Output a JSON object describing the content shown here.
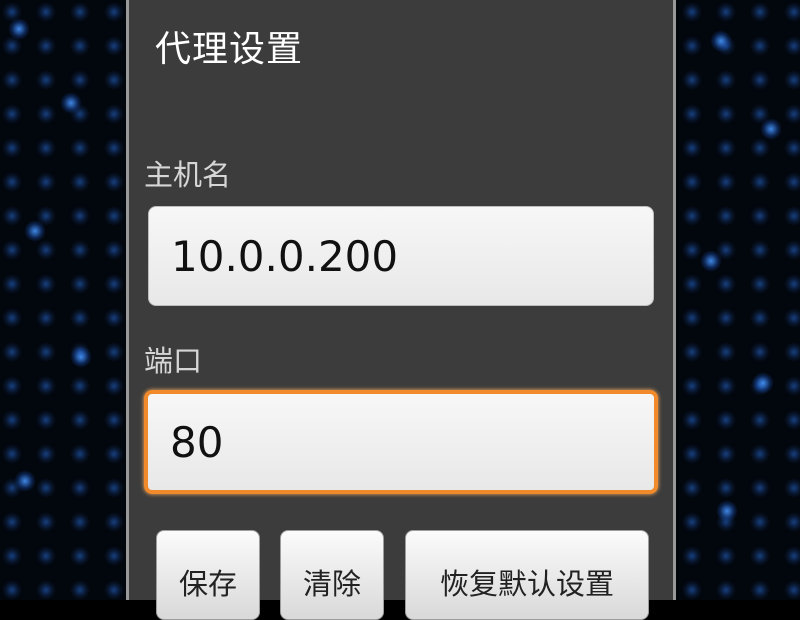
{
  "dialog": {
    "title": "代理设置",
    "host": {
      "label": "主机名",
      "value": "10.0.0.200"
    },
    "port": {
      "label": "端口",
      "value": "80"
    },
    "buttons": {
      "save": "保存",
      "clear": "清除",
      "restore_default": "恢复默认设置"
    }
  },
  "colors": {
    "dialog_background": "#3c3c3c",
    "focus_border": "#f08a2a",
    "backdrop_dots": "#2f6fd6"
  }
}
